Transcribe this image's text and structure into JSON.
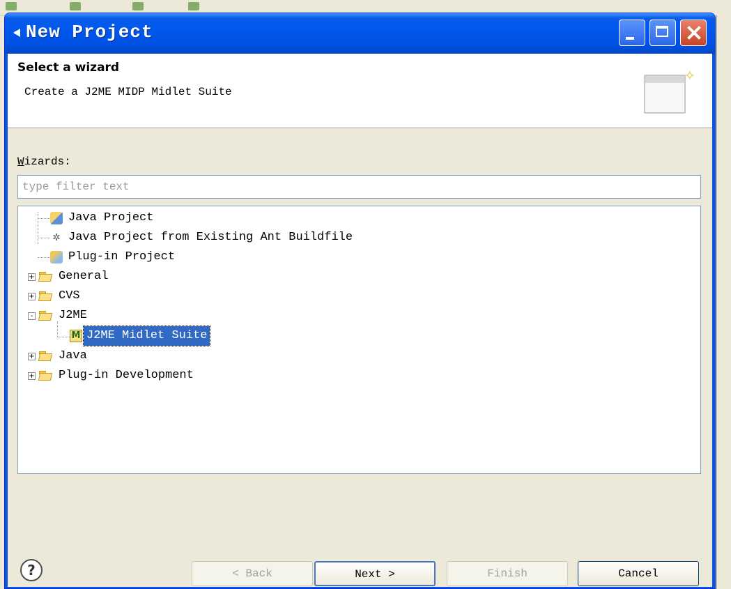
{
  "window": {
    "title": "New Project"
  },
  "header": {
    "title": "Select a wizard",
    "description": "Create a J2ME MIDP Midlet Suite"
  },
  "wizards": {
    "label_prefix": "W",
    "label_rest": "izards:",
    "filter_placeholder": "type filter text",
    "filter_value": ""
  },
  "tree": [
    {
      "label": "Java Project",
      "icon": "java-project-icon",
      "level": 1,
      "expander": "none"
    },
    {
      "label": "Java Project from Existing Ant Buildfile",
      "icon": "ant-project-icon",
      "level": 1,
      "expander": "none"
    },
    {
      "label": "Plug-in Project",
      "icon": "plugin-project-icon",
      "level": 1,
      "expander": "none"
    },
    {
      "label": "General",
      "icon": "folder-icon",
      "level": 0,
      "expander": "+"
    },
    {
      "label": "CVS",
      "icon": "folder-icon",
      "level": 0,
      "expander": "+"
    },
    {
      "label": "J2ME",
      "icon": "folder-icon",
      "level": 0,
      "expander": "-"
    },
    {
      "label": "J2ME Midlet Suite",
      "icon": "midlet-suite-icon",
      "level": 2,
      "expander": "none",
      "selected": true
    },
    {
      "label": "Java",
      "icon": "folder-icon",
      "level": 0,
      "expander": "+"
    },
    {
      "label": "Plug-in Development",
      "icon": "folder-icon",
      "level": 0,
      "expander": "+"
    }
  ],
  "buttons": {
    "back": "< Back",
    "next": "Next >",
    "finish": "Finish",
    "cancel": "Cancel"
  },
  "colors": {
    "titlebar": "#0058ee",
    "selection": "#316ac5",
    "dialog_bg": "#ece9d8"
  }
}
